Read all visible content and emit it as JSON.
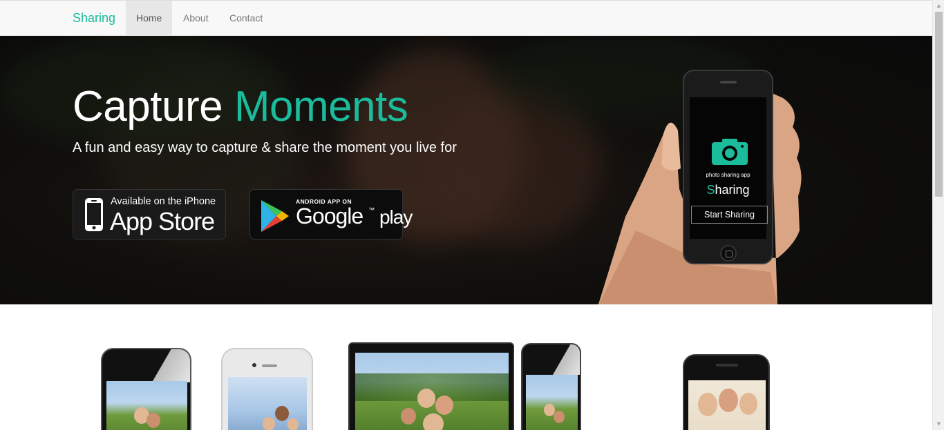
{
  "navbar": {
    "brand": "Sharing",
    "items": [
      {
        "label": "Home",
        "active": true
      },
      {
        "label": "About",
        "active": false
      },
      {
        "label": "Contact",
        "active": false
      }
    ]
  },
  "hero": {
    "title_part1": "Capture",
    "title_part2": "Moments",
    "subtitle": "A fun and easy way to capture & share the moment you live for",
    "app_store": {
      "small": "Available on the iPhone",
      "big": "App Store",
      "icon": "iphone-icon"
    },
    "google_play": {
      "small": "ANDROID APP ON",
      "big_google": "Google",
      "big_play": "play",
      "icon": "play-store-icon"
    },
    "phone_screen": {
      "icon": "camera-icon",
      "caption": "photo sharing app",
      "name_first": "S",
      "name_rest": "haring",
      "button": "Start Sharing"
    }
  },
  "colors": {
    "accent": "#1abc9c",
    "navbar_bg": "#f8f8f8",
    "active_nav_bg": "#e7e7e7"
  },
  "devices": [
    "black-iphone",
    "white-iphone",
    "ipad",
    "black-iphone",
    "black-iphone"
  ]
}
